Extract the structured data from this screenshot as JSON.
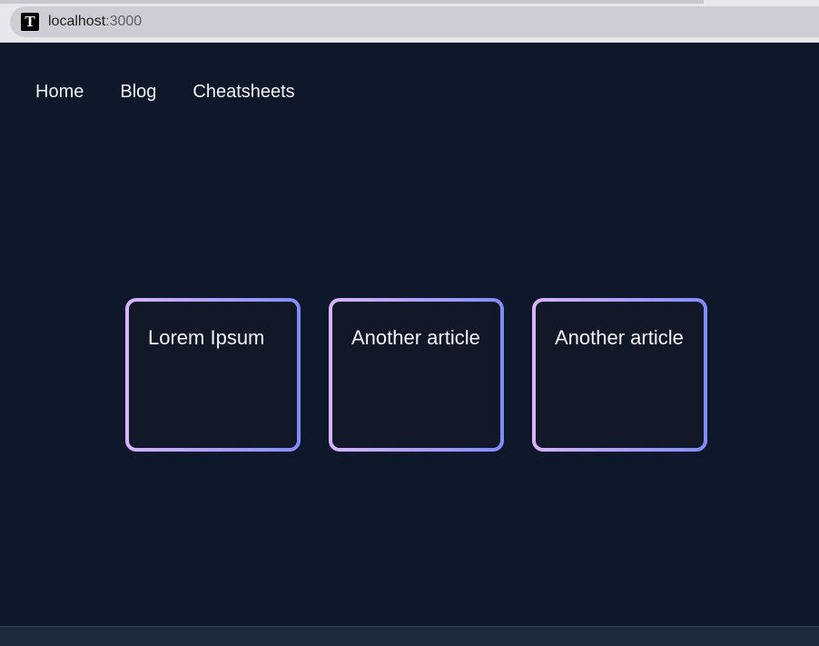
{
  "browser": {
    "url_host": "localhost",
    "url_port": ":3000",
    "favicon_letter": "T"
  },
  "nav": {
    "items": [
      {
        "label": "Home"
      },
      {
        "label": "Blog"
      },
      {
        "label": "Cheatsheets"
      }
    ]
  },
  "cards": [
    {
      "title": "Lorem Ipsum"
    },
    {
      "title": "Another article"
    },
    {
      "title": "Another article"
    }
  ],
  "colors": {
    "background": "#0f172a",
    "card_background": "#111827",
    "gradient_start": "#d8b4fe",
    "gradient_end": "#818cf8",
    "text": "#f1f5f9"
  }
}
